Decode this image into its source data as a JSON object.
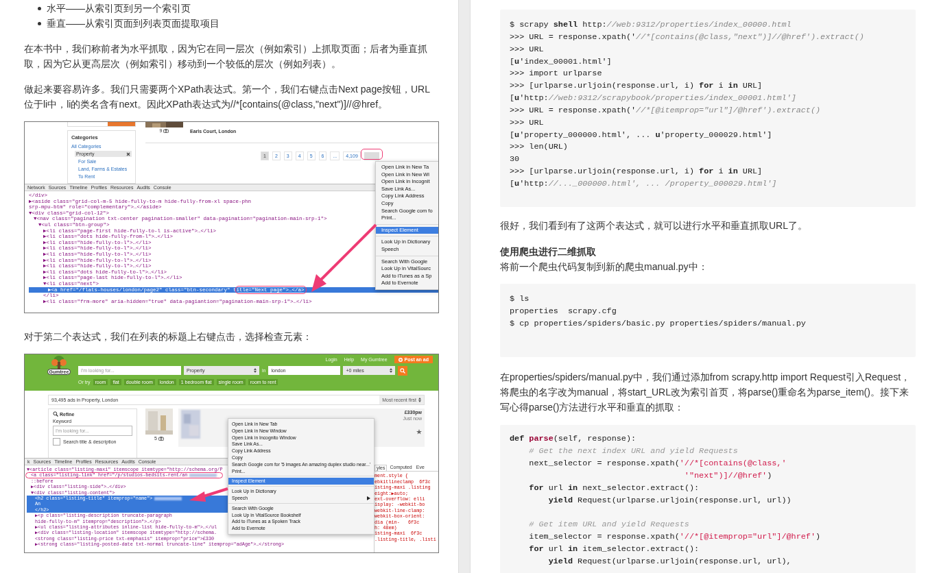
{
  "left_page": {
    "bullets": [
      "水平——从索引页到另一个索引页",
      "垂直——从索引页面到列表页面提取项目"
    ],
    "paragraphs": [
      "在本书中，我们称前者为水平抓取，因为它在同一层次（例如索引）上抓取页面；后者为垂直抓取，因为它从更高层次（例如索引）移动到一个较低的层次（例如列表）。",
      "做起来要容易许多。我们只需要两个XPath表达式。第一个，我们右键点击Next page按钮，URL位于li中，li的类名含有next。因此XPath表达式为//*[contains(@class,\"next\")]//@href。"
    ],
    "figure_1": {
      "site": {
        "photo_count": "9",
        "location": "Earls Court, London",
        "categories_title": "Categories",
        "categories": [
          {
            "label": "All Categories",
            "selected": false,
            "children": [
              {
                "label": "Property",
                "selected": true,
                "children": [
                  {
                    "label": "For Sale",
                    "selected": false
                  },
                  {
                    "label": "Land, Farms & Estates",
                    "selected": false
                  },
                  {
                    "label": "To Rent",
                    "selected": false
                  }
                ]
              }
            ]
          }
        ],
        "pages": [
          {
            "label": "1",
            "selected": true
          },
          {
            "label": "2",
            "selected": false
          },
          {
            "label": "3",
            "selected": false
          },
          {
            "label": "4",
            "selected": false
          },
          {
            "label": "5",
            "selected": false
          },
          {
            "label": "6",
            "selected": false
          },
          {
            "label": "...",
            "selected": false
          },
          {
            "label": "4,109",
            "selected": false
          }
        ]
      },
      "devtools_tabs": [
        "Network",
        "Sources",
        "Timeline",
        "Profiles",
        "Resources",
        "Audits",
        "Console"
      ],
      "dom": [
        {
          "text": "</div>",
          "selected": false
        },
        {
          "text": "▶<aside class=\"grid-col-m-5 hide-fully-to-m hide-fully-from-xl space-phn\nsrp-mpu-btm\" role=\"complementary\">…</aside>",
          "selected": false
        },
        {
          "text": "▼<div class=\"grid-col-12\">",
          "selected": false,
          "children": [
            {
              "text": "▼<nav class=\"pagination txt-center pagination-smaller\" data-pagination=\"pagination-main-srp-1\">",
              "selected": false,
              "children": [
                {
                  "text": "▼<ul class=\"btn-group\">",
                  "selected": false,
                  "children": [
                    {
                      "text": "▶<li class=\"page-first hide-fully-to-l is-active\">…</li>",
                      "selected": false
                    },
                    {
                      "text": "▶<li class=\"dots hide-fully-from-l\">…</li>",
                      "selected": false
                    },
                    {
                      "text": "▶<li class=\"hide-fully-to-l\">…</li>",
                      "selected": false
                    },
                    {
                      "text": "▶<li class=\"hide-fully-to-l\">…</li>",
                      "selected": false
                    },
                    {
                      "text": "▶<li class=\"hide-fully-to-l\">…</li>",
                      "selected": false
                    },
                    {
                      "text": "▶<li class=\"hide-fully-to-l\">…</li>",
                      "selected": false
                    },
                    {
                      "text": "▶<li class=\"hide-fully-to-l\">…</li>",
                      "selected": false
                    },
                    {
                      "text": "▶<li class=\"dots hide-fully-to-l\">…</li>",
                      "selected": false
                    },
                    {
                      "text": "▶<li class=\"page-last hide-fully-to-l\">…</li>",
                      "selected": false
                    },
                    {
                      "text": "▼<li class=\"next\">",
                      "selected": false,
                      "children": [
                        {
                          "text": "▶<a href=\"/flats-houses/london/page2\" class=\"btn-secondary\" title=\"Next page\">…</a>",
                          "selected": true
                        }
                      ]
                    },
                    {
                      "text": "</li>",
                      "selected": false
                    },
                    {
                      "text": "▶<li class=\"frm-more\" aria-hidden=\"true\" data-pagiantion=\"pagination-main-srp-1\">…</li>",
                      "selected": false
                    }
                  ]
                }
              ]
            }
          ]
        }
      ],
      "context_menu": [
        [
          {
            "label": "Open Link in New Ta",
            "selected": false
          },
          {
            "label": "Open Link in New Wi",
            "selected": false
          },
          {
            "label": "Open Link in Incognit",
            "selected": false
          },
          {
            "label": "Save Link As...",
            "selected": false
          },
          {
            "label": "Copy Link Address",
            "selected": false
          },
          {
            "label": "Copy",
            "selected": false
          },
          {
            "label": "Search Google com fo",
            "selected": false
          },
          {
            "label": "Print...",
            "selected": false
          }
        ],
        [
          {
            "label": "Inspect Element",
            "selected": true
          }
        ],
        [
          {
            "label": "Look Up in Dictionary",
            "selected": false
          },
          {
            "label": "Speech",
            "selected": false
          }
        ],
        [
          {
            "label": "Search With Google",
            "selected": false
          },
          {
            "label": "Look Up in VitalSourc",
            "selected": false
          },
          {
            "label": "Add to iTunes as a Sp",
            "selected": false
          },
          {
            "label": "Add to Evernote",
            "selected": false
          }
        ]
      ]
    },
    "caption": "对于第二个表达式，我们在列表的标题上右键点击，选择检查元素：",
    "figure_2": {
      "site": {
        "nav_links": [
          "Login",
          "Help",
          "My Gumtree"
        ],
        "post_button": "Post an ad",
        "logo": "Gumtree",
        "search": {
          "placeholder": "I'm looking for...",
          "category": "Property",
          "in_label": "in",
          "location": "london",
          "distance": "+0 miles"
        },
        "or_try_label": "Or try",
        "suggestions": [
          "room",
          "flat",
          "double room",
          "london",
          "1 bedroom flat",
          "single room",
          "room to rent"
        ],
        "result_count": "93,495 ads in Property, London",
        "sort": "Most recent first",
        "refine": {
          "title": "Refine",
          "keyword_label": "Keyword",
          "placeholder": "I'm looking for...",
          "checkbox_label": "Search title & description",
          "checked": false
        },
        "listing": {
          "photo_count": "5",
          "price": "£330pw",
          "posted": "Just now"
        }
      },
      "devtools_tabs": [
        "k",
        "Sources",
        "Timeline",
        "Profiles",
        "Resources",
        "Audits",
        "Console"
      ],
      "dom": [
        {
          "text": "▼<article class=\"listing-maxi\" itemscope itemtype=\"http://schema.org/P",
          "selected": false,
          "children": [
            {
              "text": "<a class=\"listing-link\" href=\"/p/studios-bedsits-rent/an",
              "selected": false
            },
            {
              "text": "::before",
              "selected": false
            },
            {
              "text": "▶<div class=\"listing-side\">…</div>",
              "selected": false
            },
            {
              "text": "▼<div class=\"listing-content\">",
              "selected": false,
              "children": [
                {
                  "text": "<h2 class=\"listing-title\" itemprop=\"name\">",
                  "selected": true
                },
                {
                  "text": "An",
                  "selected": true
                },
                {
                  "text": "</h2>",
                  "selected": true
                },
                {
                  "text": "▶<p class=\"listing-description truncate-paragraph\nhide-fully-to-m\" itemprop=\"description\">…</p>",
                  "selected": false
                },
                {
                  "text": "▶<ul class=\"listing-attributes inline-list hide-fully-to-m\">…</ul",
                  "selected": false
                },
                {
                  "text": "▶<div class=\"listing-location\" itemscope itemtype=\"http://schema.",
                  "selected": false
                },
                {
                  "text": "<strong class=\"listing-price txt-emphasis\" itemprop=\"price\">£330",
                  "selected": false
                },
                {
                  "text": "▶<strong class=\"listing-posted-date txt-normal truncate-line\" itemprop=\"adAge\">…</strong>",
                  "selected": false
                }
              ]
            }
          ]
        }
      ],
      "styles_tabs": [
        {
          "label": "yles",
          "selected": true
        },
        {
          "label": "Computed",
          "selected": false
        },
        {
          "label": "Eve",
          "selected": false
        }
      ],
      "styles_lines": [
        "ment.style {",
        "ebkitlineclamp  6f3c",
        "isting-maxi .listing",
        "eight:▶auto;",
        "ext-overflow: elli",
        "isplay: -webkit-bo",
        "webkit-line-clamp:",
        "webkit-box-orient:",
        "dia (min-   6f3c",
        "h: 48em)",
        "isting-maxi  6f3c",
        ".listing-title, .listi"
      ],
      "context_menu": [
        [
          {
            "label": "Open Link in New Tab",
            "selected": false,
            "submenu": false
          },
          {
            "label": "Open Link in New Window",
            "selected": false,
            "submenu": false
          },
          {
            "label": "Open Link in Incognito Window",
            "selected": false,
            "submenu": false
          },
          {
            "label": "Save Link As...",
            "selected": false,
            "submenu": false
          },
          {
            "label": "Copy Link Address",
            "selected": false,
            "submenu": false
          },
          {
            "label": "Copy",
            "selected": false,
            "submenu": false
          },
          {
            "label": "Search Google com for '5 images An amazing duplex studio near...'",
            "selected": false,
            "submenu": false
          },
          {
            "label": "Print...",
            "selected": false,
            "submenu": false
          }
        ],
        [
          {
            "label": "Inspect Element",
            "selected": true,
            "submenu": false
          }
        ],
        [
          {
            "label": "Look Up in Dictionary",
            "selected": false,
            "submenu": false
          },
          {
            "label": "Speech",
            "selected": false,
            "submenu": true
          }
        ],
        [
          {
            "label": "Search With Google",
            "selected": false,
            "submenu": false
          },
          {
            "label": "Look Up in VitalSource Bookshelf",
            "selected": false,
            "submenu": false
          },
          {
            "label": "Add to iTunes as a Spoken Track",
            "selected": false,
            "submenu": false
          },
          {
            "label": "Add to Evernote",
            "selected": false,
            "submenu": false
          }
        ]
      ]
    }
  },
  "right_page": {
    "code_block_1": [
      [
        [
          {
            "text": "$ scrapy ",
            "kind": "plain"
          },
          {
            "text": "shell",
            "kind": "bold"
          },
          {
            "text": " http:",
            "kind": "plain"
          },
          {
            "text": "//web:9312/properties/index_00000.html",
            "kind": "italic"
          }
        ],
        [
          {
            "text": ">>> URL = response.xpath('",
            "kind": "plain"
          },
          {
            "text": "//*[contains(@class,\"next\")]//@href').extract()",
            "kind": "italic"
          }
        ],
        [
          {
            "text": ">>> URL",
            "kind": "plain"
          }
        ],
        [
          {
            "text": "[",
            "kind": "plain"
          },
          {
            "text": "u",
            "kind": "bold"
          },
          {
            "text": "'index_00001.html']",
            "kind": "plain"
          }
        ],
        [
          {
            "text": ">>> import urlparse",
            "kind": "plain"
          }
        ],
        [
          {
            "text": ">>> [urlparse.urljoin(response.url, i) ",
            "kind": "plain"
          },
          {
            "text": "for",
            "kind": "bold"
          },
          {
            "text": " i ",
            "kind": "plain"
          },
          {
            "text": "in",
            "kind": "bold"
          },
          {
            "text": " URL]",
            "kind": "plain"
          }
        ],
        [
          {
            "text": "[",
            "kind": "plain"
          },
          {
            "text": "u",
            "kind": "bold"
          },
          {
            "text": "'http:",
            "kind": "plain"
          },
          {
            "text": "//web:9312/scrapybook/properties/index_00001.html']",
            "kind": "italic"
          }
        ],
        [
          {
            "text": ">>> URL = response.xpath('",
            "kind": "plain"
          },
          {
            "text": "//*[@itemprop=\"url\"]/@href').extract()",
            "kind": "italic"
          }
        ],
        [
          {
            "text": ">>> URL",
            "kind": "plain"
          }
        ],
        [
          {
            "text": "[",
            "kind": "plain"
          },
          {
            "text": "u",
            "kind": "bold"
          },
          {
            "text": "'property_000000.html', ... ",
            "kind": "plain"
          },
          {
            "text": "u",
            "kind": "bold"
          },
          {
            "text": "'property_000029.html']",
            "kind": "plain"
          }
        ],
        [
          {
            "text": ">>> len(URL)",
            "kind": "plain"
          }
        ],
        [
          {
            "text": "30",
            "kind": "plain"
          }
        ],
        [
          {
            "text": ">>> [urlparse.urljoin(response.url, i) ",
            "kind": "plain"
          },
          {
            "text": "for",
            "kind": "bold"
          },
          {
            "text": " i ",
            "kind": "plain"
          },
          {
            "text": "in",
            "kind": "bold"
          },
          {
            "text": " URL]",
            "kind": "plain"
          }
        ],
        [
          {
            "text": "[",
            "kind": "plain"
          },
          {
            "text": "u",
            "kind": "bold"
          },
          {
            "text": "'http:",
            "kind": "plain"
          },
          {
            "text": "//..._000000.html', ... /property_000029.html']",
            "kind": "italic"
          }
        ]
      ]
    ],
    "paragraph_1": "很好，我们看到有了这两个表达式，就可以进行水平和垂直抓取URL了。",
    "heading": "使用爬虫进行二维抓取",
    "paragraph_2": "将前一个爬虫代码复制到新的爬虫manual.py中：",
    "code_block_2": [
      [
        [
          {
            "text": "$ ls",
            "kind": "plain"
          }
        ],
        [
          {
            "text": "properties  scrapy.cfg",
            "kind": "plain"
          }
        ],
        [
          {
            "text": "$ cp properties/spiders/basic.py properties/spiders/manual.py",
            "kind": "plain"
          }
        ]
      ]
    ],
    "paragraph_3": "在properties/spiders/manual.py中，我们通过添加from scrapy.http import Request引入Request，将爬虫的名字改为manual，将start_URL改为索引首页，将parse()重命名为parse_item()。接下来写心得parse()方法进行水平和垂直的抓取：",
    "code_block_3": [
      [
        [
          {
            "text": "def ",
            "kind": "bold"
          },
          {
            "text": "parse",
            "kind": "func"
          },
          {
            "text": "(self, response):",
            "kind": "plain"
          }
        ],
        [
          {
            "text": "    # Get the next index URL and yield Requests",
            "kind": "comment"
          }
        ],
        [
          {
            "text": "    next_selector = response.xpath(",
            "kind": "plain"
          },
          {
            "text": "'//*[contains(@class,'",
            "kind": "string"
          }
        ],
        [
          {
            "text": "                                    '\"next\")]//@href'",
            "kind": "string"
          },
          {
            "text": ")",
            "kind": "plain"
          }
        ],
        [
          {
            "text": "    for",
            "kind": "bold"
          },
          {
            "text": " url ",
            "kind": "plain"
          },
          {
            "text": "in",
            "kind": "bold"
          },
          {
            "text": " next_selector.extract():",
            "kind": "plain"
          }
        ],
        [
          {
            "text": "        yield",
            "kind": "bold"
          },
          {
            "text": " Request(urlparse.urljoin(response.url, url))",
            "kind": "plain"
          }
        ]
      ],
      [
        [
          {
            "text": "    # Get item URL and yield Requests",
            "kind": "comment"
          }
        ],
        [
          {
            "text": "    item_selector = response.xpath(",
            "kind": "plain"
          },
          {
            "text": "'//*[@itemprop=\"url\"]/@href'",
            "kind": "string"
          },
          {
            "text": ")",
            "kind": "plain"
          }
        ],
        [
          {
            "text": "    for",
            "kind": "bold"
          },
          {
            "text": " url ",
            "kind": "plain"
          },
          {
            "text": "in",
            "kind": "bold"
          },
          {
            "text": " item_selector.extract():",
            "kind": "plain"
          }
        ],
        [
          {
            "text": "        yield",
            "kind": "bold"
          },
          {
            "text": " Request(urlparse.urljoin(response.url, url),",
            "kind": "plain"
          }
        ]
      ]
    ]
  }
}
